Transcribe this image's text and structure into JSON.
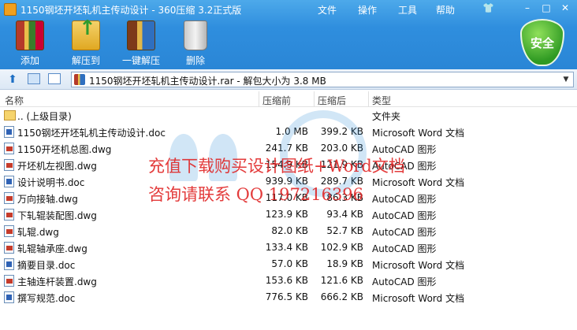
{
  "window": {
    "title": "1150钢坯开坯轧机主传动设计 - 360压缩 3.2正式版",
    "menu": [
      "文件",
      "操作",
      "工具",
      "帮助"
    ]
  },
  "toolbar": {
    "add_label": "添加",
    "extract_label": "解压到",
    "one_click_label": "一键解压",
    "delete_label": "删除",
    "security_label": "安全"
  },
  "address": {
    "text": "1150钢坯开坯轧机主传动设计.rar - 解包大小为 3.8 MB"
  },
  "columns": {
    "name": "名称",
    "size": "压缩前",
    "packed": "压缩后",
    "type": "类型"
  },
  "files": [
    {
      "name": ".. (上级目录)",
      "size": "",
      "packed": "",
      "type": "文件夹",
      "icon": "folder"
    },
    {
      "name": "1150钢坯开坯轧机主传动设计.doc",
      "size": "1.0 MB",
      "packed": "399.2 KB",
      "type": "Microsoft Word 文档",
      "icon": "doc"
    },
    {
      "name": "1150开坯机总图.dwg",
      "size": "241.7 KB",
      "packed": "203.0 KB",
      "type": "AutoCAD 图形",
      "icon": "dwg"
    },
    {
      "name": "开坯机左视图.dwg",
      "size": "154.9 KB",
      "packed": "121.9 KB",
      "type": "AutoCAD 图形",
      "icon": "dwg"
    },
    {
      "name": "设计说明书.doc",
      "size": "939.9 KB",
      "packed": "289.7 KB",
      "type": "Microsoft Word 文档",
      "icon": "doc"
    },
    {
      "name": "万向接轴.dwg",
      "size": "117.0 KB",
      "packed": "86.3 KB",
      "type": "AutoCAD 图形",
      "icon": "dwg"
    },
    {
      "name": "下轧辊装配图.dwg",
      "size": "123.9 KB",
      "packed": "93.4 KB",
      "type": "AutoCAD 图形",
      "icon": "dwg"
    },
    {
      "name": "轧辊.dwg",
      "size": "82.0 KB",
      "packed": "52.7 KB",
      "type": "AutoCAD 图形",
      "icon": "dwg"
    },
    {
      "name": "轧辊轴承座.dwg",
      "size": "133.4 KB",
      "packed": "102.9 KB",
      "type": "AutoCAD 图形",
      "icon": "dwg"
    },
    {
      "name": "摘要目录.doc",
      "size": "57.0 KB",
      "packed": "18.9 KB",
      "type": "Microsoft Word 文档",
      "icon": "doc"
    },
    {
      "name": "主轴连杆装置.dwg",
      "size": "153.6 KB",
      "packed": "121.6 KB",
      "type": "AutoCAD 图形",
      "icon": "dwg"
    },
    {
      "name": "撰写规范.doc",
      "size": "776.5 KB",
      "packed": "666.2 KB",
      "type": "Microsoft Word 文档",
      "icon": "doc"
    }
  ],
  "watermark": {
    "line1": "充值下载购买设计图纸+Word文档",
    "line2": "咨询请联系 QQ 197216396"
  }
}
